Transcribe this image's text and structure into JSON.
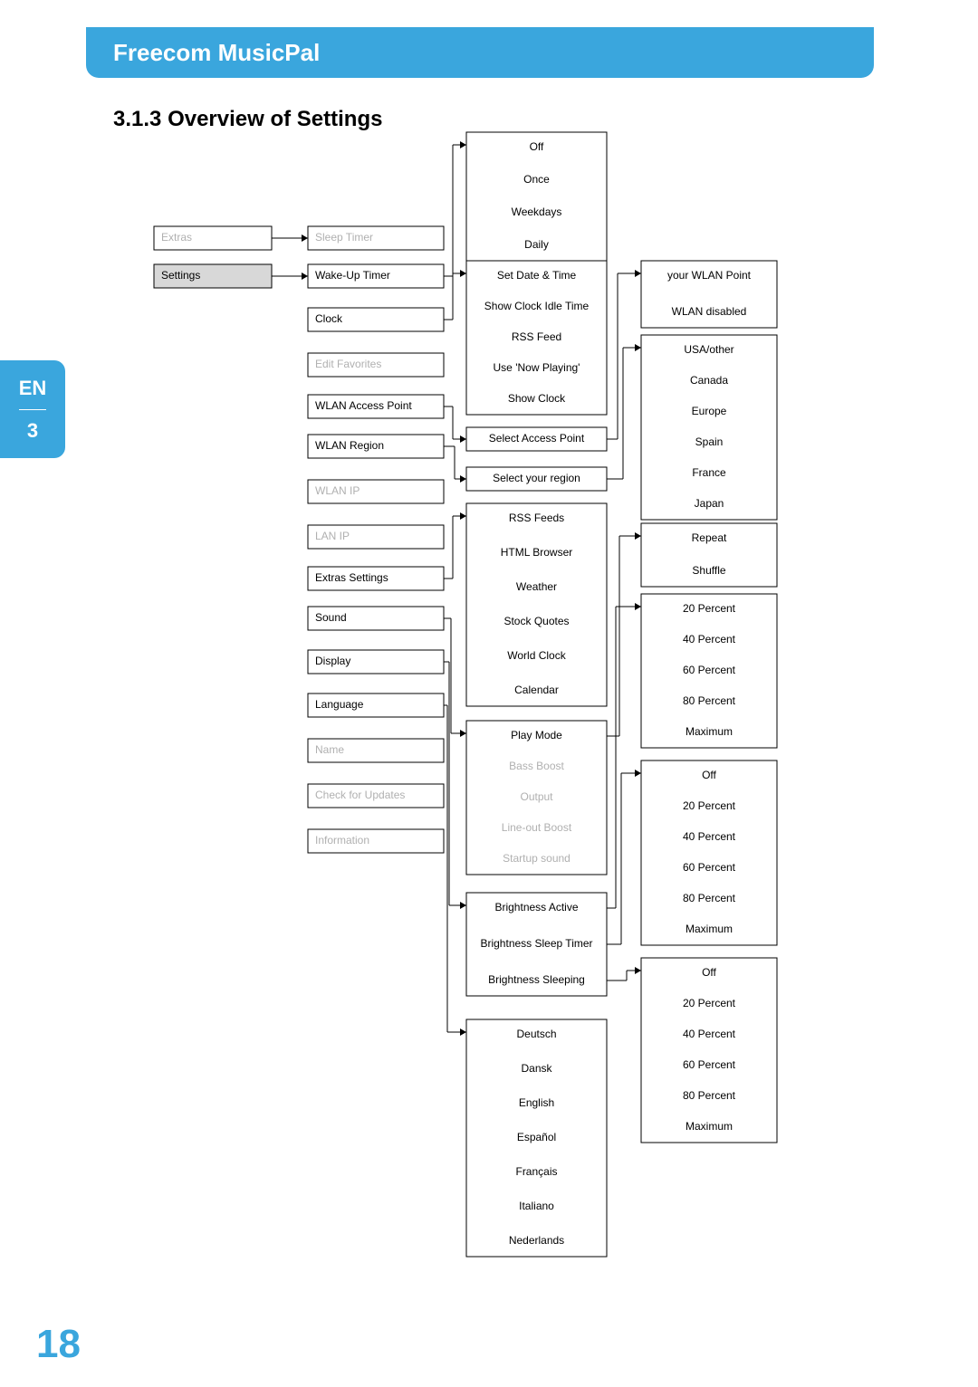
{
  "header": {
    "title": "Freecom MusicPal"
  },
  "sideTab": {
    "lang": "EN",
    "chapter": "3"
  },
  "pageNumber": "18",
  "section": {
    "number": "3.1.3",
    "title": "Overview of Settings"
  },
  "diagram": {
    "col1": [
      {
        "label": "Extras",
        "dim": true,
        "filled": false
      },
      {
        "label": "Settings",
        "dim": false,
        "filled": true
      }
    ],
    "col2": [
      {
        "label": "Sleep Timer",
        "dim": true
      },
      {
        "label": "Wake-Up Timer",
        "dim": false
      },
      {
        "label": "Clock",
        "dim": false
      },
      {
        "label": "Edit Favorites",
        "dim": true
      },
      {
        "label": "WLAN Access Point",
        "dim": false
      },
      {
        "label": "WLAN Region",
        "dim": false
      },
      {
        "label": "WLAN IP",
        "dim": true
      },
      {
        "label": "LAN IP",
        "dim": true
      },
      {
        "label": "Extras Settings",
        "dim": false
      },
      {
        "label": "Sound",
        "dim": false
      },
      {
        "label": "Display",
        "dim": false
      },
      {
        "label": "Language",
        "dim": false
      },
      {
        "label": "Name",
        "dim": true
      },
      {
        "label": "Check for Updates",
        "dim": true
      },
      {
        "label": "Information",
        "dim": true
      }
    ],
    "col3_groupA": [
      {
        "label": "Off"
      },
      {
        "label": "Once"
      },
      {
        "label": "Weekdays"
      },
      {
        "label": "Daily"
      }
    ],
    "col3_groupB": [
      {
        "label": "Set Date & Time"
      },
      {
        "label": "Show Clock Idle Time"
      },
      {
        "label": "RSS Feed"
      },
      {
        "label": "Use 'Now Playing'"
      },
      {
        "label": "Show Clock"
      }
    ],
    "col3_accessPoint": [
      {
        "label": "Select Access Point"
      }
    ],
    "col3_region": [
      {
        "label": "Select your region"
      }
    ],
    "col3_extras": [
      {
        "label": "RSS Feeds"
      },
      {
        "label": "HTML Browser"
      },
      {
        "label": "Weather"
      },
      {
        "label": "Stock Quotes"
      },
      {
        "label": "World Clock"
      },
      {
        "label": "Calendar"
      }
    ],
    "col3_sound": [
      {
        "label": "Play Mode"
      },
      {
        "label": "Bass Boost",
        "dim": true
      },
      {
        "label": "Output",
        "dim": true
      },
      {
        "label": "Line-out Boost",
        "dim": true
      },
      {
        "label": "Startup sound",
        "dim": true
      }
    ],
    "col3_display": [
      {
        "label": "Brightness Active"
      },
      {
        "label": "Brightness Sleep Timer"
      },
      {
        "label": "Brightness Sleeping"
      }
    ],
    "col3_language": [
      {
        "label": "Deutsch"
      },
      {
        "label": "Dansk"
      },
      {
        "label": "English"
      },
      {
        "label": "Español"
      },
      {
        "label": "Français"
      },
      {
        "label": "Italiano"
      },
      {
        "label": "Nederlands"
      }
    ],
    "col4_wlanPoint": [
      {
        "label": "your WLAN Point"
      },
      {
        "label": "WLAN disabled"
      }
    ],
    "col4_region": [
      {
        "label": "USA/other"
      },
      {
        "label": "Canada"
      },
      {
        "label": "Europe"
      },
      {
        "label": "Spain"
      },
      {
        "label": "France"
      },
      {
        "label": "Japan"
      }
    ],
    "col4_playmode": [
      {
        "label": "Repeat"
      },
      {
        "label": "Shuffle"
      }
    ],
    "col4_brightActive": [
      {
        "label": "20 Percent"
      },
      {
        "label": "40 Percent"
      },
      {
        "label": "60 Percent"
      },
      {
        "label": "80 Percent"
      },
      {
        "label": "Maximum"
      }
    ],
    "col4_brightSleep": [
      {
        "label": "Off"
      },
      {
        "label": "20 Percent"
      },
      {
        "label": "40 Percent"
      },
      {
        "label": "60 Percent"
      },
      {
        "label": "80 Percent"
      },
      {
        "label": "Maximum"
      }
    ],
    "col4_brightSleeping": [
      {
        "label": "Off"
      },
      {
        "label": "20 Percent"
      },
      {
        "label": "40 Percent"
      },
      {
        "label": "60 Percent"
      },
      {
        "label": "80 Percent"
      },
      {
        "label": "Maximum"
      }
    ]
  }
}
